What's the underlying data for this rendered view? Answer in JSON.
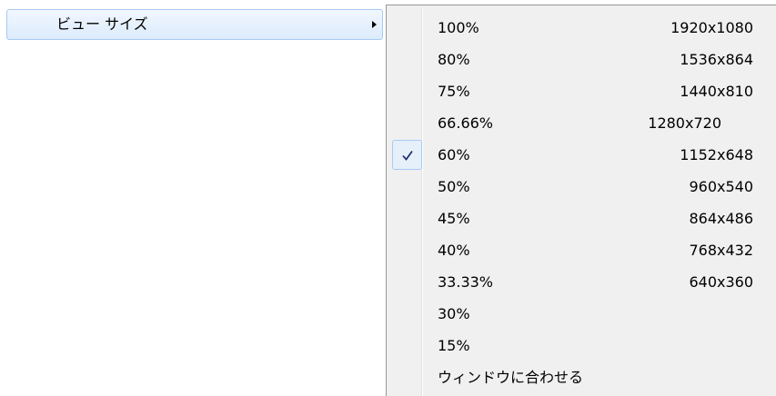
{
  "parent_menu": {
    "items": [
      {
        "label": "ビュー サイズ",
        "has_submenu": true,
        "highlighted": true,
        "icon": "submenu-arrow-icon"
      }
    ]
  },
  "submenu": {
    "check_icon": "checkmark-icon",
    "items": [
      {
        "label": "100%",
        "resolution": "1920x1080",
        "checked": false
      },
      {
        "label": "80%",
        "resolution": "1536x864",
        "checked": false
      },
      {
        "label": "75%",
        "resolution": "1440x810",
        "checked": false
      },
      {
        "label": "66.66%",
        "resolution": "1280x720",
        "checked": false
      },
      {
        "label": "60%",
        "resolution": "1152x648",
        "checked": true
      },
      {
        "label": "50%",
        "resolution": "960x540",
        "checked": false
      },
      {
        "label": "45%",
        "resolution": "864x486",
        "checked": false
      },
      {
        "label": "40%",
        "resolution": "768x432",
        "checked": false
      },
      {
        "label": "33.33%",
        "resolution": "640x360",
        "checked": false
      },
      {
        "label": "30%",
        "checked": false
      },
      {
        "label": "15%",
        "checked": false
      },
      {
        "label": "ウィンドウに合わせる",
        "checked": false
      }
    ]
  },
  "colors": {
    "highlight_border": "#a8cbf2",
    "highlight_fill_top": "#f1f7fe",
    "highlight_fill_bottom": "#dcebfc",
    "menu_background": "#f0f0f0",
    "menu_border": "#979797",
    "check_color": "#1c2a6a"
  }
}
